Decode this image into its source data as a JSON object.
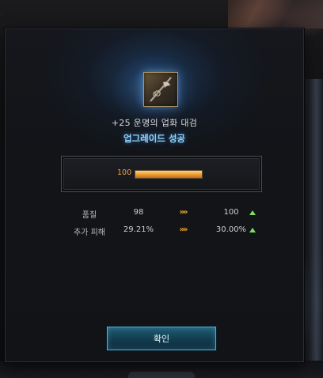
{
  "item": {
    "icon": "weapon-axe-icon",
    "name": "+25 운명의 업화 대검"
  },
  "result": {
    "title": "업그레이드 성공"
  },
  "gauge": {
    "value_text": "100",
    "fill_fraction": 1.0
  },
  "stats": [
    {
      "label": "품질",
      "before": "98",
      "arrows": "»»",
      "after": "100",
      "trend_icon": "up-triangle-icon"
    },
    {
      "label": "추가 피해",
      "before": "29.21%",
      "arrows": "»»",
      "after": "30.00%",
      "trend_icon": "up-triangle-icon"
    }
  ],
  "buttons": {
    "confirm": "확인"
  },
  "colors": {
    "accent_blue": "#8fd4ff",
    "gauge_orange": "#f3a43a",
    "arrow_orange": "#f0a52a",
    "up_green": "#7ee060",
    "button_teal": "#1f5b73"
  }
}
